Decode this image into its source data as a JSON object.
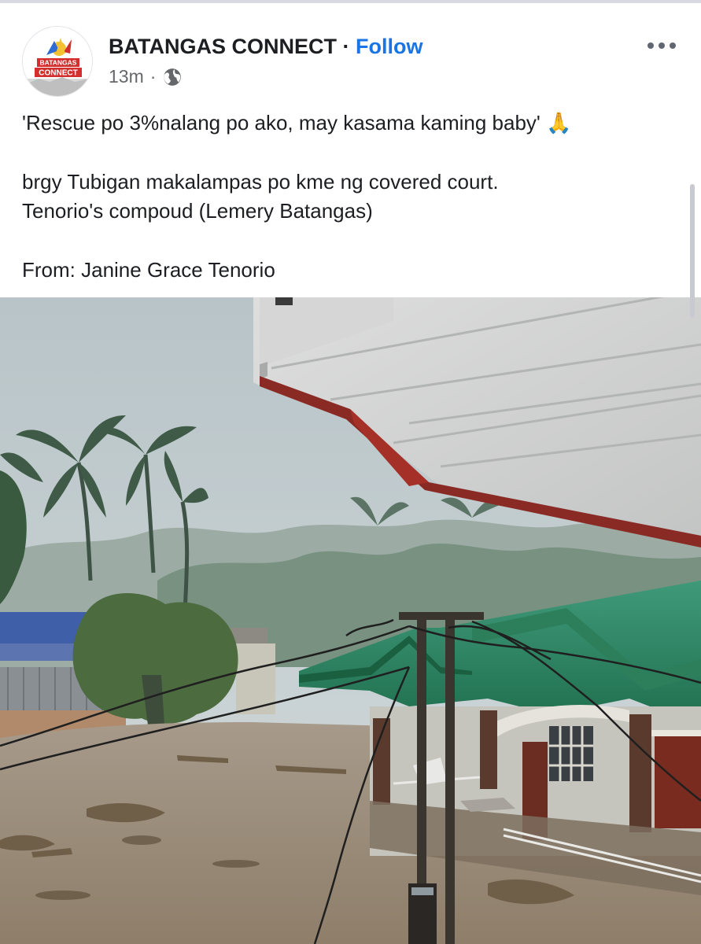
{
  "post": {
    "page_name": "BATANGAS CONNECT",
    "separator": "·",
    "follow_label": "Follow",
    "time_ago": "13m",
    "meta_separator": "·",
    "privacy_icon": "globe-icon",
    "more_icon": "more-horizontal-icon",
    "avatar": {
      "line1": "BATANGAS",
      "line2": "CONNECT"
    },
    "text": {
      "line1": "'Rescue po 3%nalang po ako, may kasama kaming baby' 🙏",
      "line2": "brgy Tubigan makalampas po kme ng covered court.",
      "line3": "Tenorio's compoud (Lemery Batangas)",
      "line4": "From: Janine Grace Tenorio"
    }
  },
  "colors": {
    "link": "#1b74e4",
    "secondary_text": "#65676b",
    "primary_text": "#1c1e21"
  }
}
